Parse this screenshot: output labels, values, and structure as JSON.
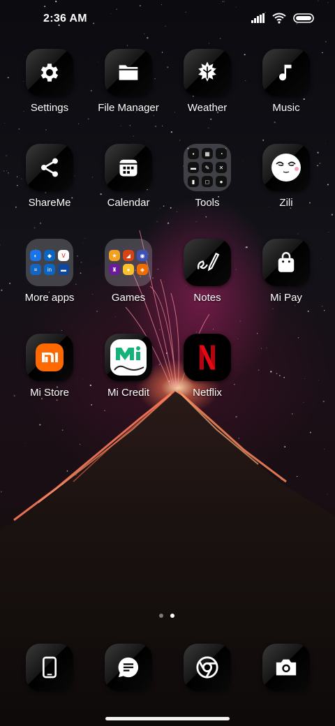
{
  "status_bar": {
    "time": "2:36 AM"
  },
  "apps": [
    {
      "id": "settings",
      "label": "Settings",
      "icon": "gear-icon"
    },
    {
      "id": "file-manager",
      "label": "File Manager",
      "icon": "folder-icon"
    },
    {
      "id": "weather",
      "label": "Weather",
      "icon": "weather-icon"
    },
    {
      "id": "music",
      "label": "Music",
      "icon": "music-note-icon"
    },
    {
      "id": "shareme",
      "label": "ShareMe",
      "icon": "share-icon"
    },
    {
      "id": "calendar",
      "label": "Calendar",
      "icon": "calendar-icon"
    },
    {
      "id": "tools",
      "label": "Tools",
      "icon": "folder-tools"
    },
    {
      "id": "zili",
      "label": "Zili",
      "icon": "zili-face-icon"
    },
    {
      "id": "more-apps",
      "label": "More apps",
      "icon": "folder-more-apps"
    },
    {
      "id": "games",
      "label": "Games",
      "icon": "folder-games"
    },
    {
      "id": "notes",
      "label": "Notes",
      "icon": "pen-icon"
    },
    {
      "id": "mi-pay",
      "label": "Mi Pay",
      "icon": "shopping-bag-icon"
    },
    {
      "id": "mi-store",
      "label": "Mi Store",
      "icon": "mi-store-logo"
    },
    {
      "id": "mi-credit",
      "label": "Mi Credit",
      "icon": "mi-credit-logo"
    },
    {
      "id": "netflix",
      "label": "Netflix",
      "icon": "netflix-logo"
    }
  ],
  "dock": [
    {
      "id": "phone",
      "icon": "phone-icon"
    },
    {
      "id": "messages",
      "icon": "message-icon"
    },
    {
      "id": "chrome",
      "icon": "chrome-icon"
    },
    {
      "id": "camera",
      "icon": "camera-icon"
    }
  ],
  "pager": {
    "pages": 2,
    "current": 2
  },
  "colors": {
    "mi_orange": "#ff6900",
    "netflix_red": "#e50914",
    "mi_credit_green": "#17b27a"
  }
}
